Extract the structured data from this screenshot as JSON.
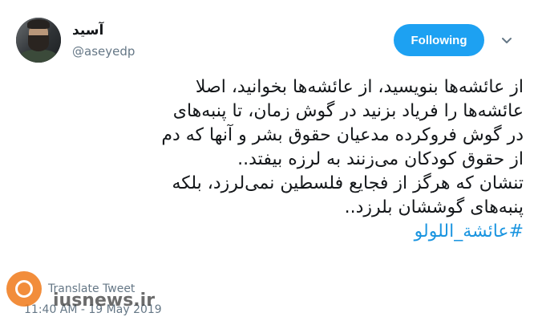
{
  "user": {
    "display_name": "آسید",
    "handle": "@aseyedp"
  },
  "follow_button": {
    "label": "Following"
  },
  "tweet": {
    "lines": [
      "از عائشه‌ها بنویسید، از عائشه‌ها بخوانید، اصلا",
      "عائشه‌ها را فریاد بزنید در گوش زمان، تا پنبه‌های",
      "در گوش فروکرده مدعیان حقوق بشر و آنها که دم",
      "از حقوق کودکان می‌زنند به لرزه بیفتد..",
      "تنشان که هرگز از فجایع فلسطین نمی‌لرزد، بلکه",
      "پنبه‌های گوششان بلرزد.."
    ],
    "hashtag": "#عائشة_اللولو"
  },
  "translate_label": "Translate Tweet",
  "timestamp": "11:40 AM - 19 May 2019",
  "watermark": {
    "site": "iusnews.ir"
  },
  "colors": {
    "accent": "#1da1f2",
    "hashtag": "#1b95e0",
    "text": "#14171a",
    "muted": "#657786"
  },
  "icons": {
    "caret": "chevron-down-icon",
    "avatar": "avatar"
  }
}
